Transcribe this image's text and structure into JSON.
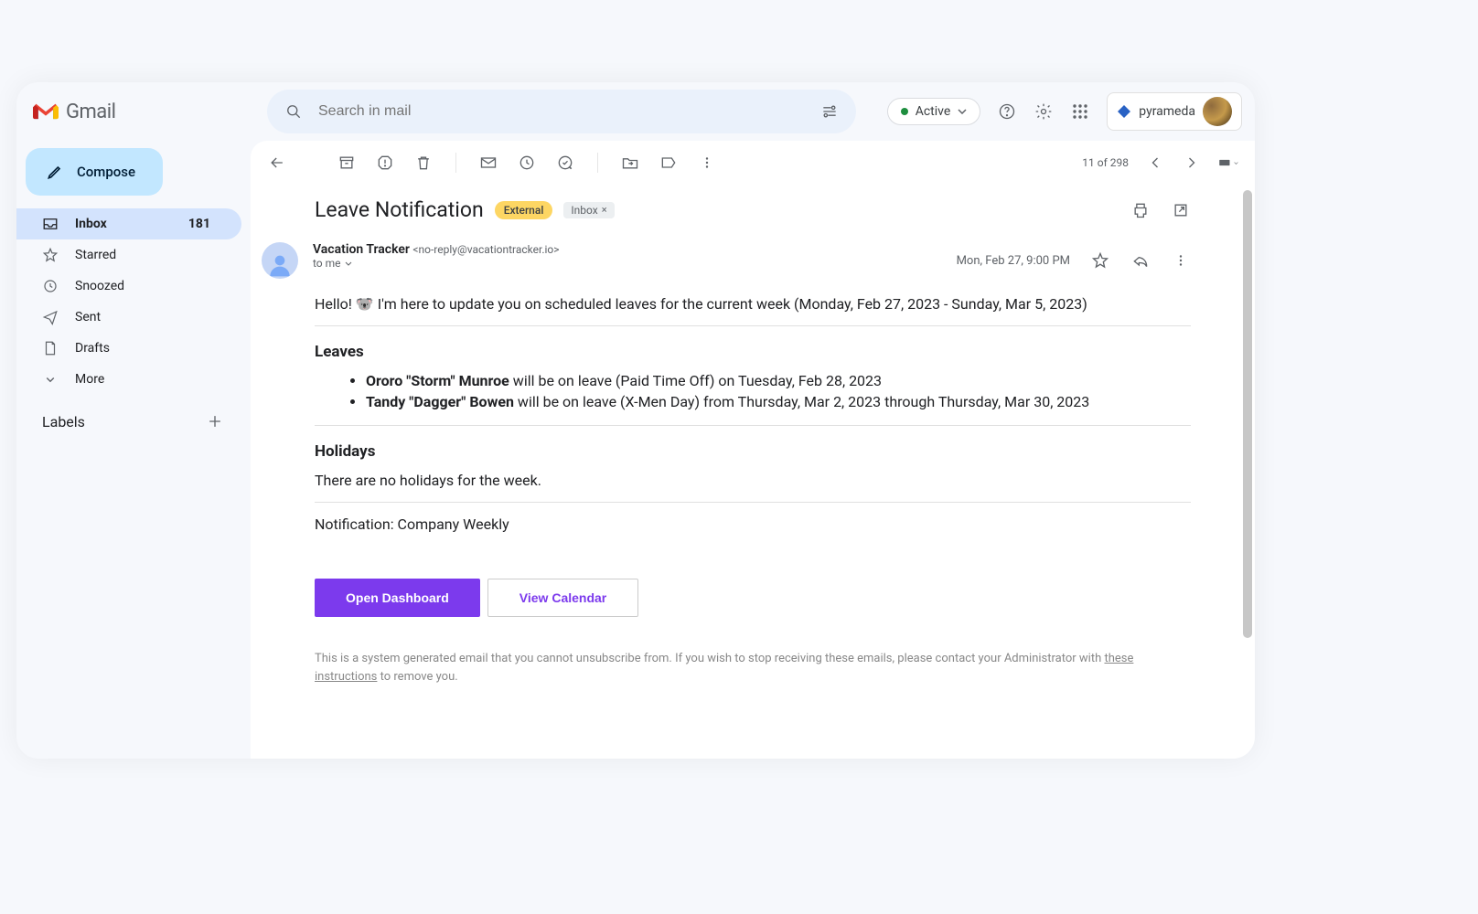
{
  "app": {
    "name": "Gmail"
  },
  "search": {
    "placeholder": "Search in mail"
  },
  "status": {
    "label": "Active"
  },
  "org": {
    "name": "pyrameda"
  },
  "compose": {
    "label": "Compose"
  },
  "sidebar": {
    "items": [
      {
        "label": "Inbox",
        "count": "181"
      },
      {
        "label": "Starred"
      },
      {
        "label": "Snoozed"
      },
      {
        "label": "Sent"
      },
      {
        "label": "Drafts"
      },
      {
        "label": "More"
      }
    ],
    "labels_header": "Labels"
  },
  "toolbar": {
    "position": "11 of 298"
  },
  "email": {
    "subject": "Leave Notification",
    "badge_external": "External",
    "badge_inbox": "Inbox",
    "sender_name": "Vacation Tracker",
    "sender_email": "<no-reply@vacationtracker.io>",
    "to_line": "to me",
    "date": "Mon, Feb 27, 9:00 PM",
    "greeting": "Hello! 🐨 I'm here to update you on scheduled leaves for the current week (Monday, Feb 27, 2023 - Sunday, Mar 5, 2023)",
    "leaves_title": "Leaves",
    "leaves": [
      {
        "name": "Ororo \"Storm\" Munroe",
        "rest": " will be on leave (Paid Time Off) on Tuesday, Feb 28, 2023"
      },
      {
        "name": "Tandy \"Dagger\" Bowen",
        "rest": " will be on leave (X-Men Day) from Thursday, Mar 2, 2023 through Thursday, Mar 30, 2023"
      }
    ],
    "holidays_title": "Holidays",
    "holidays_text": "There are no holidays for the week.",
    "notification_line": "Notification: Company Weekly",
    "cta_primary": "Open Dashboard",
    "cta_secondary": "View Calendar",
    "footer_prefix": "This is a system generated email that you cannot unsubscribe from. If you wish to stop receiving these emails, please contact your Administrator with ",
    "footer_link": "these instructions",
    "footer_suffix": " to remove you."
  }
}
